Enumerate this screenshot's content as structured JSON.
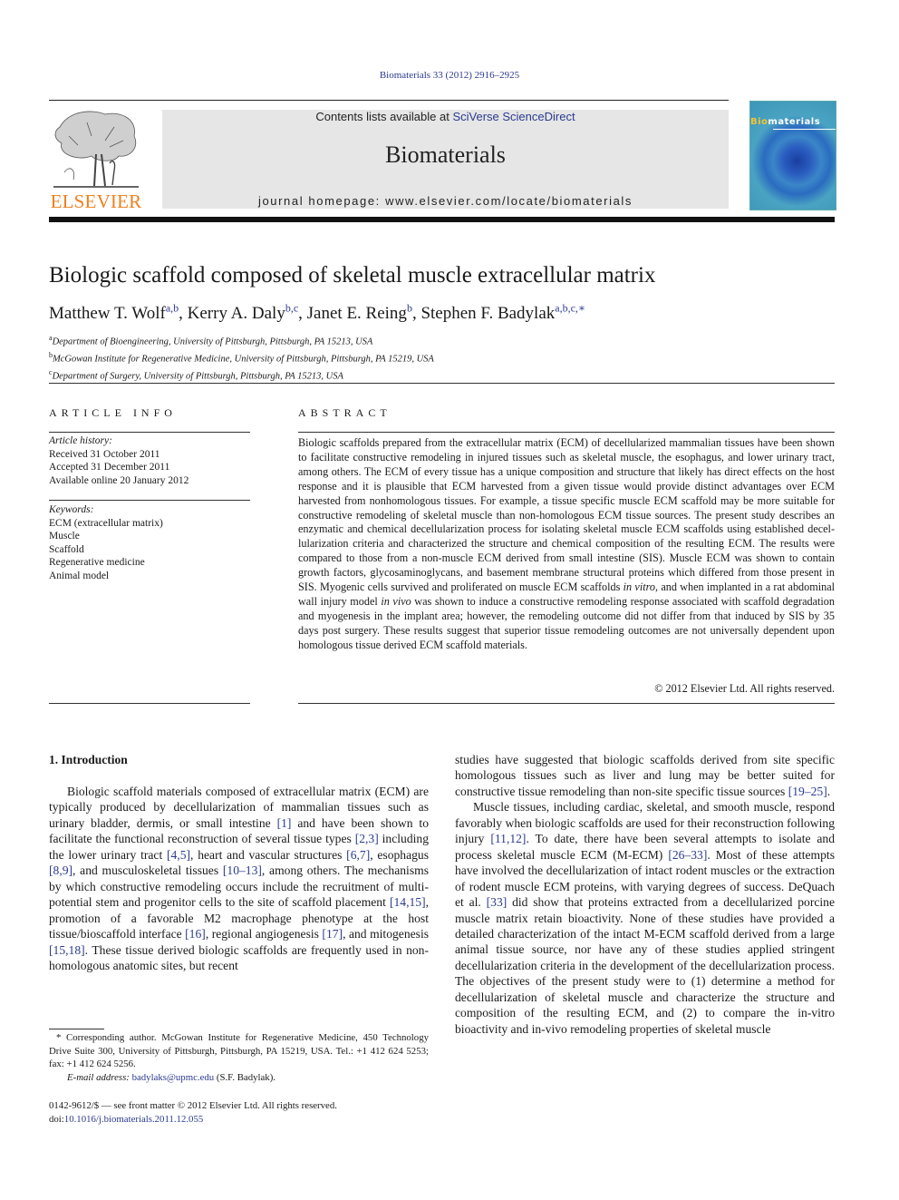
{
  "header": {
    "citation": "Biomaterials 33 (2012) 2916–2925",
    "contents_prefix": "Contents lists available at ",
    "contents_link": "SciVerse ScienceDirect",
    "journal_name": "Biomaterials",
    "homepage": "journal homepage: www.elsevier.com/locate/biomaterials",
    "publisher_logo_text": "ELSEVIER",
    "cover_title_highlight": "Bio",
    "cover_title_rest": "materials",
    "colors": {
      "link": "#2b3a8f",
      "elsevier_orange": "#f07f1c",
      "banner_gray": "#e6e6e6"
    }
  },
  "article": {
    "title": "Biologic scaffold composed of skeletal muscle extracellular matrix",
    "authors": [
      {
        "name": "Matthew T. Wolf",
        "sup": "a,b",
        "sep": ", "
      },
      {
        "name": "Kerry A. Daly",
        "sup": "b,c",
        "sep": ", "
      },
      {
        "name": "Janet E. Reing",
        "sup": "b",
        "sep": ", "
      },
      {
        "name": "Stephen F. Badylak",
        "sup": "a,b,c,∗",
        "sep": ""
      }
    ],
    "affiliations": [
      {
        "mark": "a",
        "text": "Department of Bioengineering, University of Pittsburgh, Pittsburgh, PA 15213, USA"
      },
      {
        "mark": "b",
        "text": "McGowan Institute for Regenerative Medicine, University of Pittsburgh, Pittsburgh, PA 15219, USA"
      },
      {
        "mark": "c",
        "text": "Department of Surgery, University of Pittsburgh, Pittsburgh, PA 15213, USA"
      }
    ]
  },
  "article_info": {
    "heading": "ARTICLE INFO",
    "history_label": "Article history:",
    "history": [
      "Received 31 October 2011",
      "Accepted 31 December 2011",
      "Available online 20 January 2012"
    ],
    "keywords_label": "Keywords:",
    "keywords": [
      "ECM (extracellular matrix)",
      "Muscle",
      "Scaffold",
      "Regenerative medicine",
      "Animal model"
    ]
  },
  "abstract": {
    "heading": "ABSTRACT",
    "text_1": "Biologic scaffolds prepared from the extracellular matrix (ECM) of decellularized mammalian tissues have been shown to facilitate constructive remodeling in injured tissues such as skeletal muscle, the esophagus, and lower urinary tract, among others. The ECM of every tissue has a unique composition and structure that likely has direct effects on the host response and it is plausible that ECM harvested from a given tissue would provide distinct advantages over ECM harvested from nonhomologous tissues. For example, a tissue specific muscle ECM scaffold may be more suitable for constructive remodeling of skeletal muscle than non-homologous ECM tissue sources. The present study describes an enzymatic and chemical decellularization process for isolating skeletal muscle ECM scaffolds using established decel­lularization criteria and characterized the structure and chemical composition of the resulting ECM. The results were compared to those from a non-muscle ECM derived from small intestine (SIS). Muscle ECM was shown to contain growth factors, glycosaminoglycans, and basement membrane structural proteins which differed from those present in SIS. Myogenic cells survived and proliferated on muscle ECM scaffolds ",
    "italic_1": "in vitro",
    "text_2": ", and when implanted in a rat abdominal wall injury model ",
    "italic_2": "in vivo",
    "text_3": " was shown to induce a constructive remodeling response associated with scaffold degradation and myogenesis in the implant area; however, the remodeling outcome did not differ from that induced by SIS by 35 days post surgery. These results suggest that superior tissue remodeling outcomes are not universally dependent upon homologous tissue derived ECM scaffold materials.",
    "copyright": "© 2012 Elsevier Ltd. All rights reserved."
  },
  "introduction": {
    "heading": "1.  Introduction",
    "left_para": [
      {
        "t": "Biologic scaffold materials composed of extracellular matrix (ECM) are typically produced by decellularization of mammalian tissues such as urinary bladder, dermis, or small intestine "
      },
      {
        "ref": "[1]"
      },
      {
        "t": " and have been shown to facilitate the functional reconstruction of several tissue types "
      },
      {
        "ref": "[2,3]"
      },
      {
        "t": " including the lower urinary tract "
      },
      {
        "ref": "[4,5]"
      },
      {
        "t": ", heart and vascular structures "
      },
      {
        "ref": "[6,7]"
      },
      {
        "t": ", esophagus "
      },
      {
        "ref": "[8,9]"
      },
      {
        "t": ", and musculo­skeletal tissues "
      },
      {
        "ref": "[10–13]"
      },
      {
        "t": ", among others. The mechanisms by which constructive remodeling occurs include the recruitment of multi­potential stem and progenitor cells to the site of scaffold placement "
      },
      {
        "ref": "[14,15]"
      },
      {
        "t": ", promotion of a favorable M2 macrophage phenotype at the host tissue/bioscaffold interface "
      },
      {
        "ref": "[16]"
      },
      {
        "t": ", regional angiogenesis "
      },
      {
        "ref": "[17]"
      },
      {
        "t": ", and mitogenesis "
      },
      {
        "ref": "[15,18]"
      },
      {
        "t": ". These tissue derived biologic scaffolds are frequently used in non-homologous anatomic sites, but recent"
      }
    ],
    "right_para_1": [
      {
        "t": "studies have suggested that biologic scaffolds derived from site specific homologous tissues such as liver and lung may be better suited for constructive tissue remodeling than non-site specific tissue sources "
      },
      {
        "ref": "[19–25]"
      },
      {
        "t": "."
      }
    ],
    "right_para_2": [
      {
        "t": "Muscle tissues, including cardiac, skeletal, and smooth muscle, respond favorably when biologic scaffolds are used for their reconstruction following injury "
      },
      {
        "ref": "[11,12]"
      },
      {
        "t": ". To date, there have been several attempts to isolate and process skeletal muscle ECM (M-ECM) "
      },
      {
        "ref": "[26–33]"
      },
      {
        "t": ". Most of these attempts have involved the decellularization of intact rodent muscles or the extraction of rodent muscle ECM proteins, with varying degrees of success. DeQuach et al. "
      },
      {
        "ref": "[33]"
      },
      {
        "t": " did show that proteins extracted from a decel­lularized porcine muscle matrix retain bioactivity. None of these studies have provided a detailed characterization of the intact M-ECM scaffold derived from a large animal tissue source, nor have any of these studies applied stringent decellularization criteria in the development of the decellularization process. The objectives of the present study were to (1) determine a method for decellulari­zation of skeletal muscle and characterize the structure and composition of the resulting ECM, and (2) to compare the in-vitro bioactivity and in-vivo remodeling properties of skeletal muscle"
      }
    ]
  },
  "footnote": {
    "corresponding": "* Corresponding author. McGowan Institute for Regenerative Medicine, 450 Technology Drive Suite 300, University of Pittsburgh, Pittsburgh, PA 15219, USA. Tel.: +1 412 624 5253; fax: +1 412 624 5256.",
    "email_label": "E-mail address:",
    "email": "badylaks@upmc.edu",
    "email_suffix": " (S.F. Badylak).",
    "front_matter": "0142-9612/$ — see front matter © 2012 Elsevier Ltd. All rights reserved.",
    "doi_prefix": "doi:",
    "doi": "10.1016/j.biomaterials.2011.12.055"
  }
}
